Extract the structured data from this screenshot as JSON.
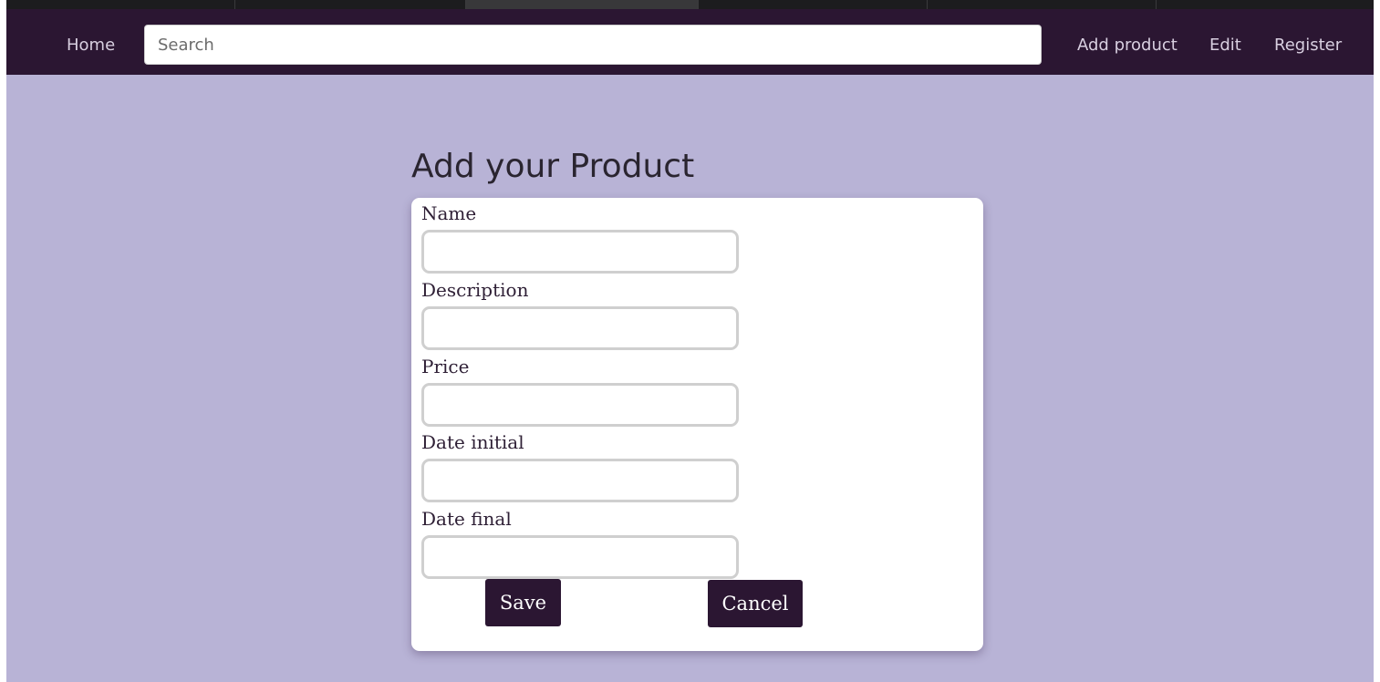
{
  "colors": {
    "navbar_bg": "#2b1632",
    "page_bg": "#b8b3d6",
    "button_bg": "#2b1632",
    "card_bg": "#ffffff"
  },
  "navbar": {
    "home_label": "Home",
    "search": {
      "placeholder": "Search",
      "value": ""
    },
    "add_product_label": "Add product",
    "edit_label": "Edit",
    "register_label": "Register"
  },
  "page": {
    "title": "Add your Product"
  },
  "form": {
    "fields": [
      {
        "label": "Name",
        "value": ""
      },
      {
        "label": "Description",
        "value": ""
      },
      {
        "label": "Price",
        "value": ""
      },
      {
        "label": "Date initial",
        "value": ""
      },
      {
        "label": "Date final",
        "value": ""
      }
    ],
    "save_label": "Save",
    "cancel_label": "Cancel"
  }
}
